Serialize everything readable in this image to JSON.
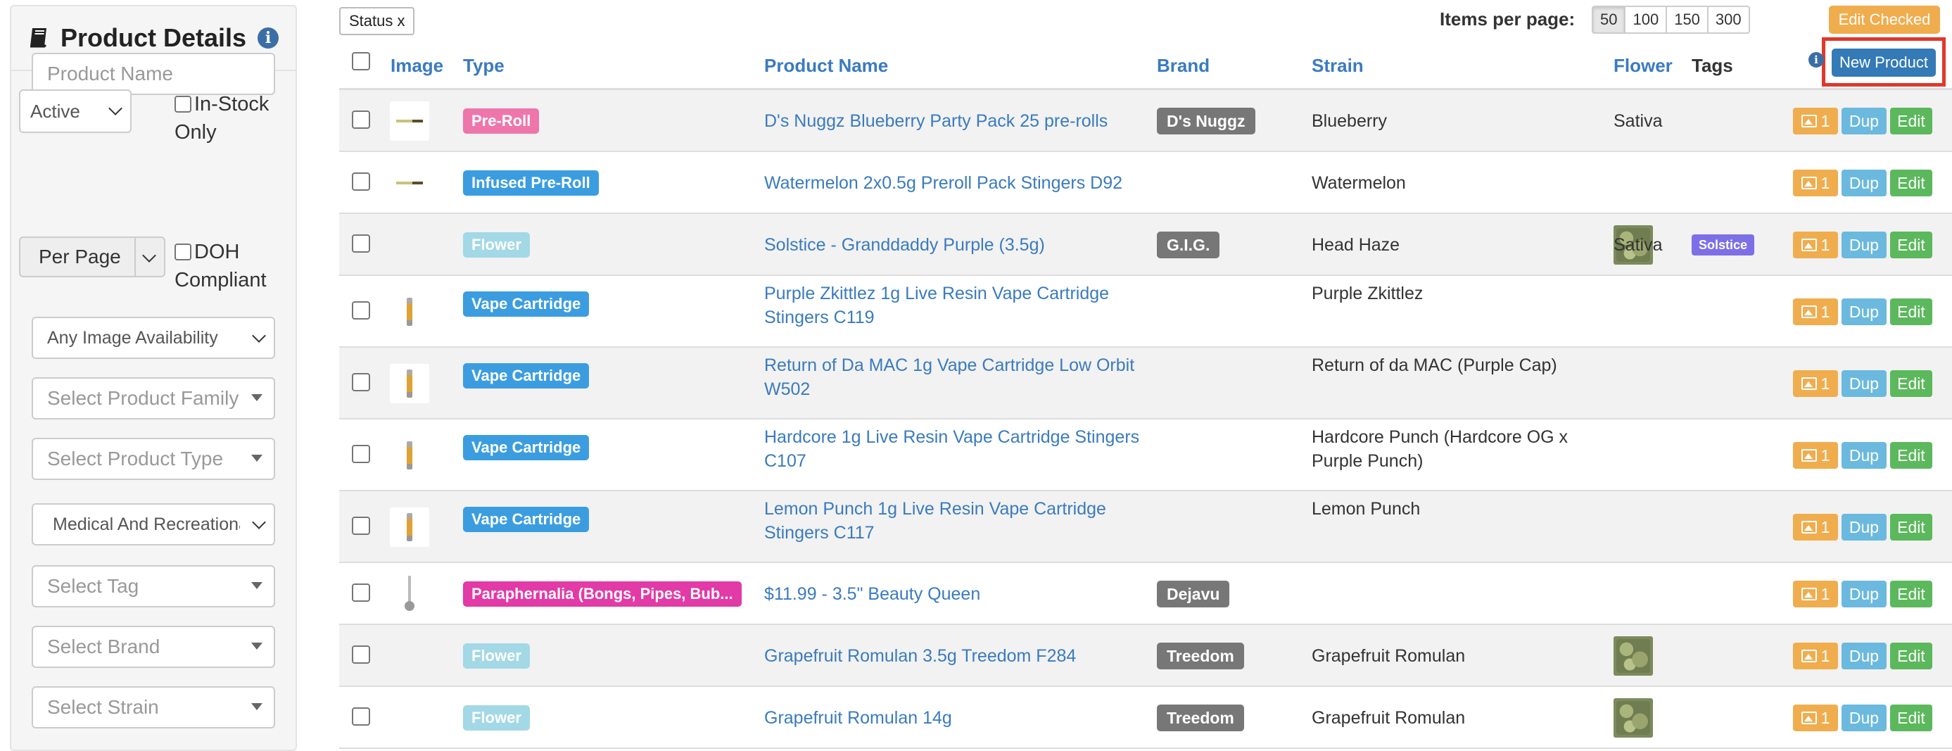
{
  "sidebar": {
    "title": "Product Details",
    "product_name_placeholder": "Product Name",
    "status_select": "Active",
    "in_stock_label": "In-Stock Only",
    "per_page_select": "Per Page",
    "doh_label": "DOH Compliant",
    "image_availability": "Any Image Availability",
    "product_family_placeholder": "Select Product Family",
    "product_type_placeholder": "Select Product Type",
    "medical_select": "Medical And Recreational",
    "tag_placeholder": "Select Tag",
    "brand_placeholder": "Select Brand",
    "strain_placeholder": "Select Strain"
  },
  "toolbar": {
    "status_chip": "Status x",
    "items_per_page_label": "Items per page:",
    "page_sizes": [
      "50",
      "100",
      "150",
      "300"
    ],
    "active_page_size": "50",
    "edit_checked_label": "Edit Checked",
    "new_product_label": "New Product"
  },
  "table": {
    "headers": {
      "image": "Image",
      "type": "Type",
      "product_name": "Product Name",
      "brand": "Brand",
      "strain": "Strain",
      "flower": "Flower",
      "tags": "Tags"
    },
    "action_labels": {
      "images_count": "1",
      "dup": "Dup",
      "edit": "Edit"
    },
    "rows": [
      {
        "thumb": "pre-roll",
        "type": "Pre-Roll",
        "type_color": "#ee76ab",
        "name": "D's Nuggz Blueberry Party Pack 25 pre-rolls",
        "brand": "D's Nuggz",
        "strain": "Blueberry",
        "flower": "Sativa",
        "tag": ""
      },
      {
        "thumb": "pre-roll",
        "type": "Infused Pre-Roll",
        "type_color": "#3b9de0",
        "name": "Watermelon 2x0.5g Preroll Pack Stingers D92",
        "brand": "",
        "strain": "Watermelon",
        "flower": "",
        "tag": ""
      },
      {
        "thumb": "flower",
        "type": "Flower",
        "type_color": "#a3d8e6",
        "name": "Solstice - Granddaddy Purple (3.5g)",
        "brand": "G.I.G.",
        "strain": "Head Haze",
        "flower": "Sativa",
        "tag": "Solstice"
      },
      {
        "thumb": "cartridge",
        "type": "Vape Cartridge",
        "type_color": "#3b9de0",
        "name": "Purple Zkittlez 1g Live Resin Vape Cartridge Stingers C119",
        "brand": "",
        "strain": "Purple Zkittlez",
        "flower": "",
        "tag": ""
      },
      {
        "thumb": "cartridge",
        "type": "Vape Cartridge",
        "type_color": "#3b9de0",
        "name": "Return of Da MAC 1g Vape Cartridge Low Orbit W502",
        "brand": "",
        "strain": "Return of da MAC (Purple Cap)",
        "flower": "",
        "tag": ""
      },
      {
        "thumb": "cartridge",
        "type": "Vape Cartridge",
        "type_color": "#3b9de0",
        "name": "Hardcore 1g Live Resin Vape Cartridge Stingers C107",
        "brand": "",
        "strain": "Hardcore Punch (Hardcore OG x Purple Punch)",
        "flower": "",
        "tag": ""
      },
      {
        "thumb": "cartridge",
        "type": "Vape Cartridge",
        "type_color": "#3b9de0",
        "name": "Lemon Punch 1g Live Resin Vape Cartridge Stingers C117",
        "brand": "",
        "strain": "Lemon Punch",
        "flower": "",
        "tag": ""
      },
      {
        "thumb": "spoon",
        "type": "Paraphernalia (Bongs, Pipes, Bub...",
        "type_color": "#e23aa6",
        "name": "$11.99 - 3.5\" Beauty Queen",
        "brand": "Dejavu",
        "strain": "",
        "flower": "",
        "tag": ""
      },
      {
        "thumb": "flower",
        "type": "Flower",
        "type_color": "#a3d8e6",
        "name": "Grapefruit Romulan 3.5g Treedom F284",
        "brand": "Treedom",
        "strain": "Grapefruit Romulan",
        "flower": "",
        "tag": ""
      },
      {
        "thumb": "flower",
        "type": "Flower",
        "type_color": "#a3d8e6",
        "name": "Grapefruit Romulan 14g",
        "brand": "Treedom",
        "strain": "Grapefruit Romulan",
        "flower": "",
        "tag": ""
      }
    ]
  }
}
